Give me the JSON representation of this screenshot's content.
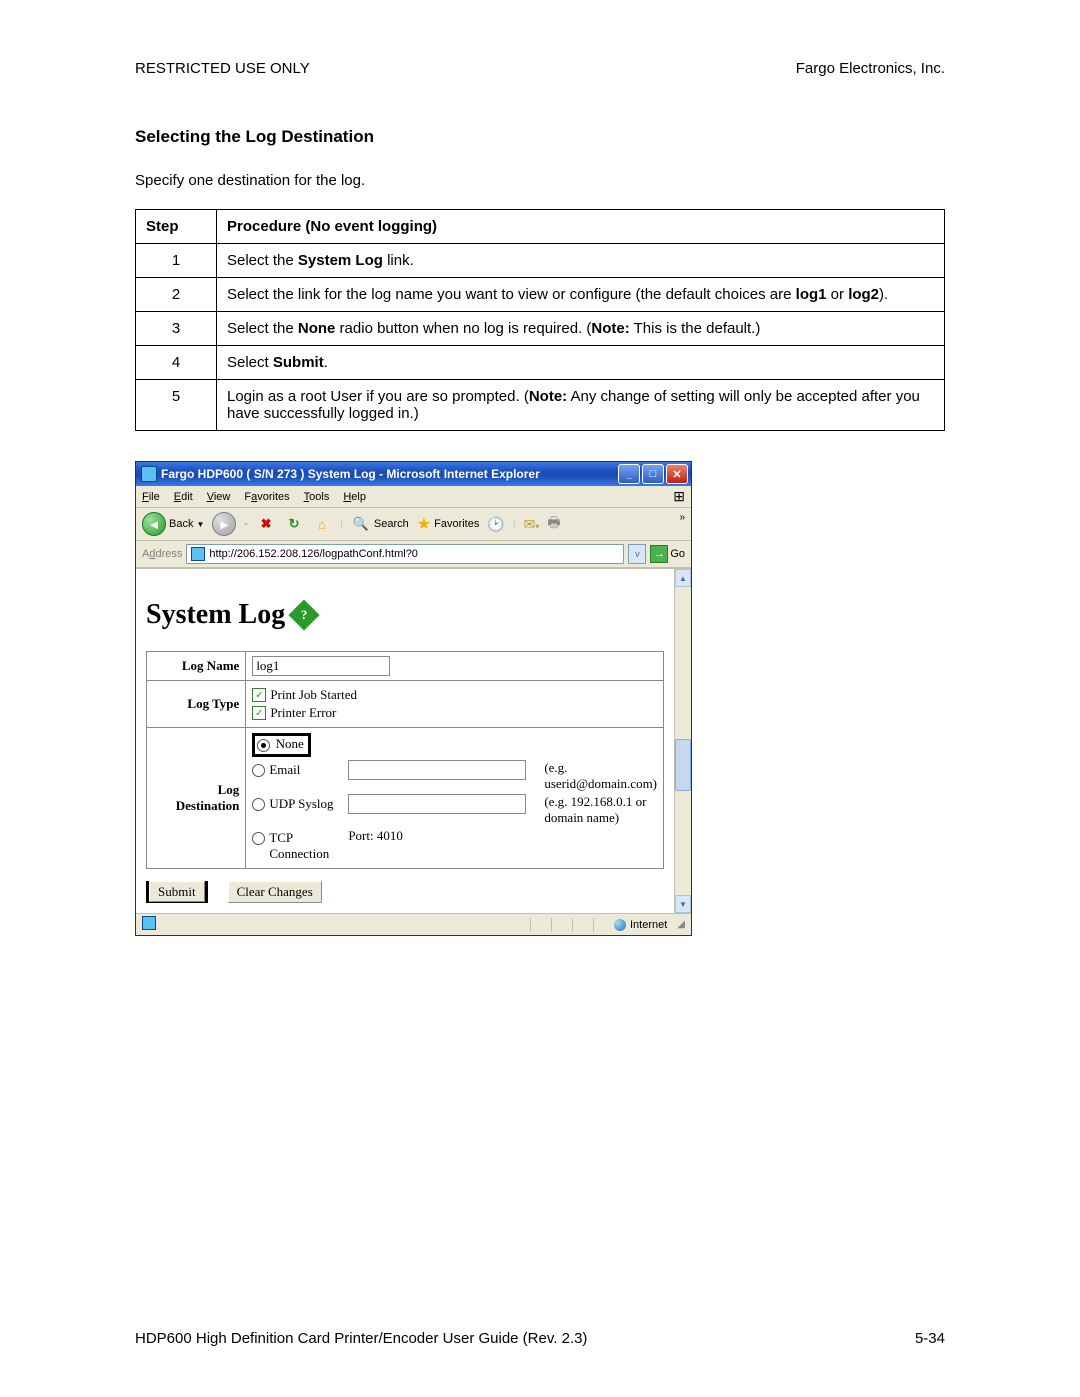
{
  "header": {
    "left": "RESTRICTED USE ONLY",
    "right": "Fargo Electronics, Inc."
  },
  "section_title": "Selecting the Log Destination",
  "intro": "Specify one destination for the log.",
  "table": {
    "head_step": "Step",
    "head_proc": "Procedure (No event logging)",
    "rows": [
      {
        "n": "1",
        "parts": [
          "Select the ",
          "System Log",
          " link."
        ]
      },
      {
        "n": "2",
        "parts": [
          "Select the link for the log name you want to view or configure (the default choices are ",
          "log1",
          " or ",
          "log2",
          ")."
        ]
      },
      {
        "n": "3",
        "parts": [
          "Select the ",
          "None",
          " radio button when no log is required. (",
          "Note:",
          "  This is the default.)"
        ]
      },
      {
        "n": "4",
        "parts": [
          "Select ",
          "Submit",
          "."
        ]
      },
      {
        "n": "5",
        "parts": [
          "Login as a root User if you are so prompted. (",
          "Note:",
          "  Any change of setting will only be accepted after you have successfully logged in.)"
        ]
      }
    ]
  },
  "ie": {
    "title": "Fargo HDP600 ( S/N 273 ) System Log - Microsoft Internet Explorer",
    "menus": {
      "file": "File",
      "edit": "Edit",
      "view": "View",
      "fav": "Favorites",
      "tools": "Tools",
      "help": "Help"
    },
    "toolbar": {
      "back": "Back",
      "search": "Search",
      "favorites": "Favorites"
    },
    "address_label": "Address",
    "url": "http://206.152.208.126/logpathConf.html?0",
    "go": "Go",
    "page": {
      "title": "System Log",
      "logname_label": "Log Name",
      "logname_value": "log1",
      "logtype_label": "Log Type",
      "logtype_opts": [
        "Print Job Started",
        "Printer Error"
      ],
      "logdest_label": "Log Destination",
      "dest": {
        "none": "None",
        "email": "Email",
        "email_hint": "(e.g. userid@domain.com)",
        "udp": "UDP Syslog",
        "udp_hint": "(e.g. 192.168.0.1 or domain name)",
        "tcp": "TCP Connection",
        "port_label": "Port:",
        "port_value": "4010"
      },
      "submit": "Submit",
      "clear": "Clear Changes"
    },
    "status_zone": "Internet"
  },
  "footer": {
    "left": "HDP600 High Definition Card Printer/Encoder User Guide (Rev. 2.3)",
    "right": "5-34"
  }
}
